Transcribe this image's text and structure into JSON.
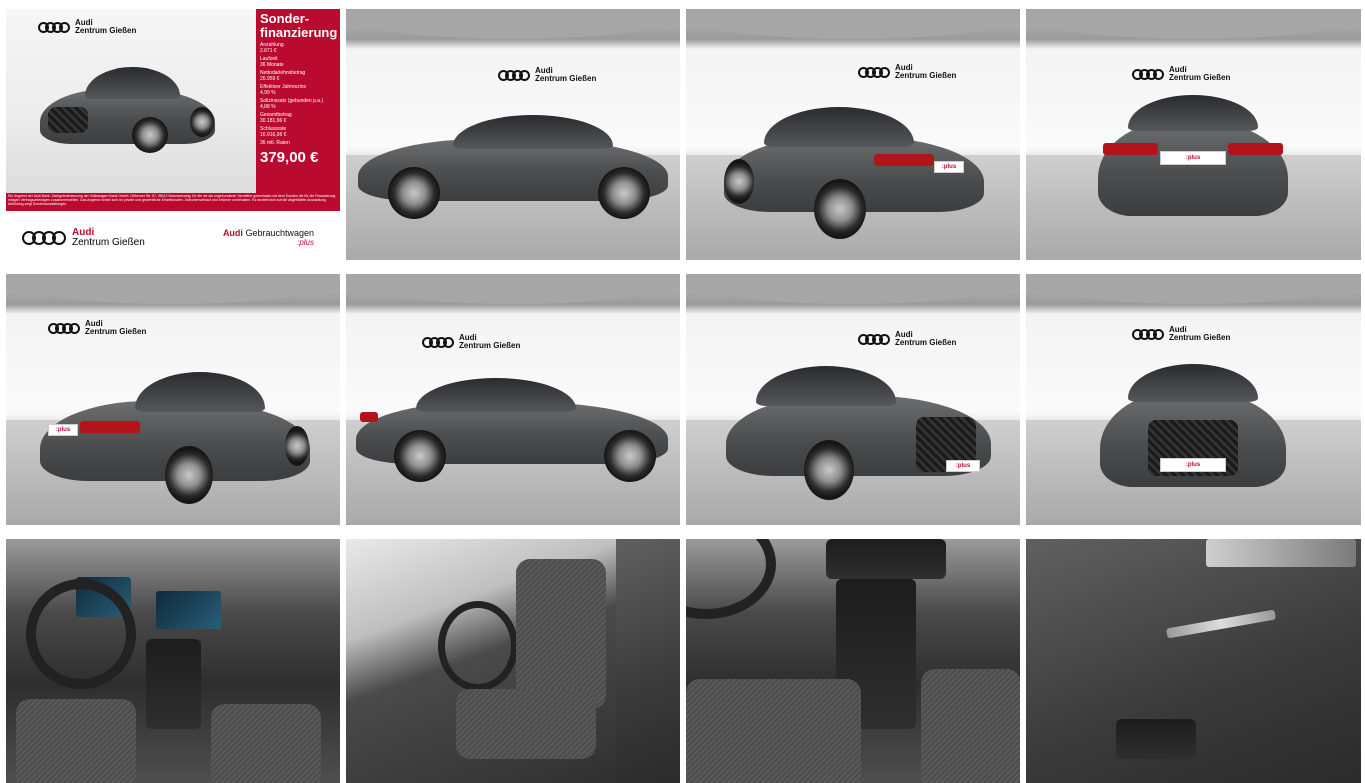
{
  "dealer": {
    "brand": "Audi",
    "name": "Zentrum Gießen"
  },
  "promo": {
    "title_line1": "Sonder-",
    "title_line2": "finanzierung",
    "rows": [
      {
        "label": "Anzahlung",
        "value": "2.871 €"
      },
      {
        "label": "Laufzeit",
        "value": "36 Monate"
      },
      {
        "label": "Nettodarlehnsbetrag",
        "value": "26.959 €"
      },
      {
        "label": "Effektiver Jahreszins",
        "value": "4,99 %"
      },
      {
        "label": "Sollzinssatz (gebunden p.a.)",
        "value": "4,88 %"
      },
      {
        "label": "Gesamtbetrag",
        "value": "30.181,96 €"
      },
      {
        "label": "Schlussrate",
        "value": "16.916,96 €"
      }
    ],
    "rate_label": "36 mtl. Raten",
    "price": "379,00 €",
    "disclaimer": "Ein Angebot der Audi Bank, Zweigniederlassung der Volkswagen Bank GmbH, Gifhorner Str. 57, 38112 Braunschweig, für die wir als ungebundener Vermittler gemeinsam mit dem Kunden die für die Finanzierung nötigen Vertragsunterlagen zusammenstellen. Das Angebot richtet sich an private und gewerbliche Einzelkunden. Zwischenverkauf und Irrtümer vorbehalten. Es bezieht sich auf die abgebildete Ausstattung. Abbildung zeigt Sonderausstattungen.",
    "footer_brand": "Audi",
    "footer_right_brand": "Audi",
    "footer_right_label": "Gebrauchtwagen",
    "footer_right_sub": ":plus"
  },
  "plate_text": ":plus",
  "gallery": [
    {
      "id": "promo"
    },
    {
      "id": "side-left"
    },
    {
      "id": "rear-left"
    },
    {
      "id": "rear"
    },
    {
      "id": "rear-left-2"
    },
    {
      "id": "side-right"
    },
    {
      "id": "front-right"
    },
    {
      "id": "front"
    },
    {
      "id": "cockpit"
    },
    {
      "id": "front-seat"
    },
    {
      "id": "center-console"
    },
    {
      "id": "door-panel"
    }
  ]
}
